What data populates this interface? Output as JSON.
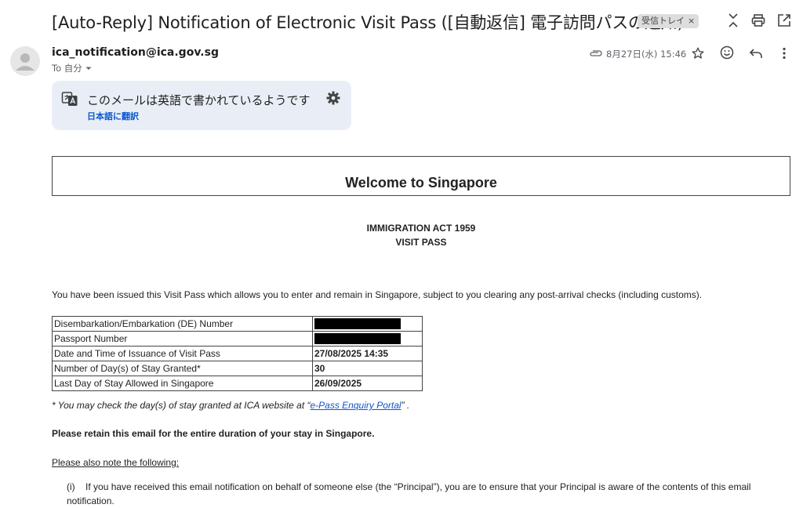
{
  "subject": "[Auto-Reply] Notification of Electronic Visit Pass ([自動返信] 電子訪問パスの通知)",
  "label_chip": {
    "text": "受信トレイ",
    "remove": "×"
  },
  "toolbar_icons": [
    "expand-collapse-icon",
    "print-icon",
    "open-in-new-window-icon"
  ],
  "sender": {
    "email": "ica_notification@ica.gov.sg",
    "to_label": "To 自分",
    "date": "8月27日(水) 15:46"
  },
  "header_icons": [
    "attachment-icon",
    "star-icon",
    "emoji-icon",
    "reply-icon",
    "more-icon"
  ],
  "translate": {
    "message": "このメールは英語で書かれているようです",
    "action": "日本語に翻訳"
  },
  "email_body": {
    "welcome": "Welcome to Singapore",
    "act_title": "IMMIGRATION ACT 1959",
    "pass_title": "VISIT PASS",
    "intro": "You have been issued this Visit Pass which allows you to enter and remain in Singapore, subject to you clearing any post-arrival checks (including customs).",
    "table": [
      {
        "label": "Disembarkation/Embarkation (DE) Number",
        "value": "",
        "redacted": true
      },
      {
        "label": "Passport Number",
        "value": "",
        "redacted": true
      },
      {
        "label": "Date and Time of Issuance of Visit Pass",
        "value": "27/08/2025 14:35",
        "redacted": false
      },
      {
        "label": "Number of Day(s) of Stay Granted*",
        "value": "30",
        "redacted": false
      },
      {
        "label": "Last Day of Stay Allowed in Singapore",
        "value": "26/09/2025",
        "redacted": false
      }
    ],
    "note_prefix": "* You may check the day(s) of stay granted at ICA website at “",
    "note_link": "e-Pass Enquiry Portal",
    "note_suffix": "” .",
    "retain": "Please retain this email for the entire duration of your stay in Singapore.",
    "also_note": "Please also note the following:",
    "item_i_marker": "(i)",
    "item_i_text": "If you have received this email notification on behalf of someone else (the “Principal”), you are to ensure that your Principal is aware of the contents of this email notification."
  }
}
